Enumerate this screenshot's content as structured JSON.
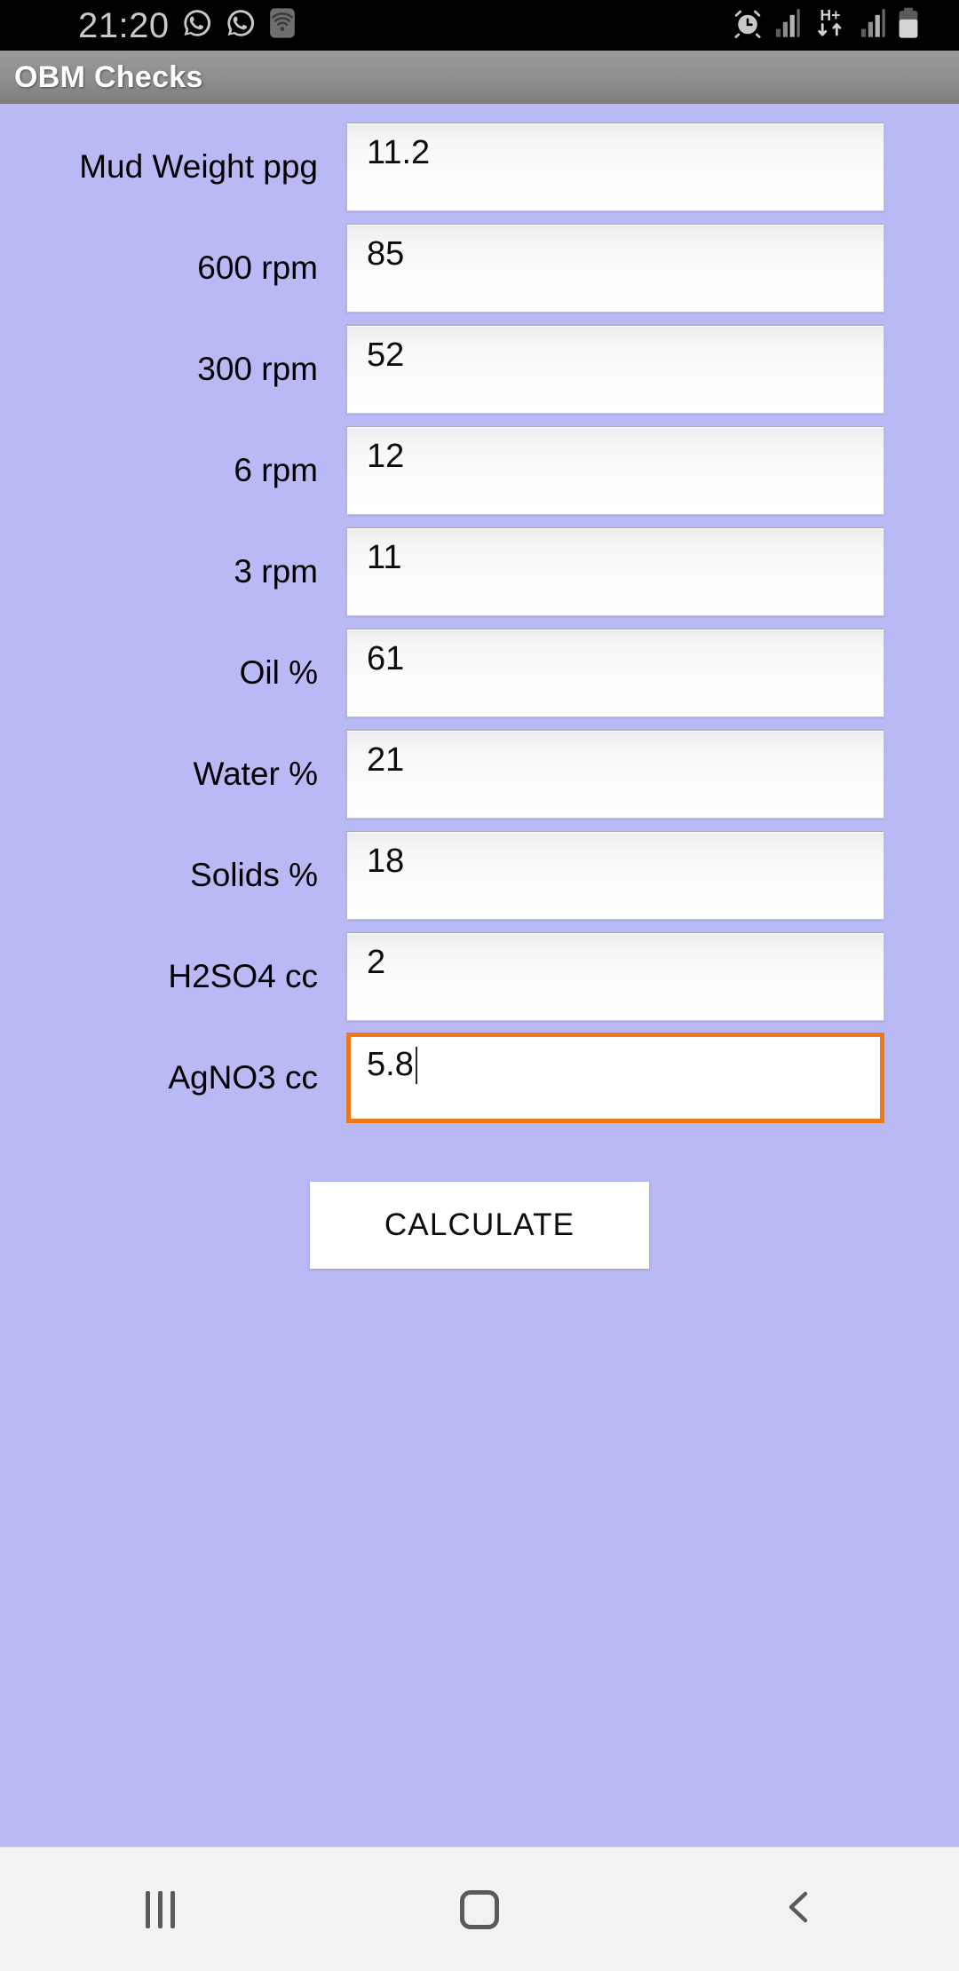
{
  "status_bar": {
    "time": "21:20",
    "left_icons": [
      "whatsapp-icon",
      "whatsapp-icon",
      "wifi-icon"
    ],
    "right_icons": [
      "alarm-icon",
      "signal-bars-icon",
      "hplus-data-icon",
      "signal-bars-icon",
      "battery-icon"
    ],
    "network_label": "H+",
    "background_color": "#000000",
    "foreground_color": "#c8c8c8"
  },
  "app_bar": {
    "title": "OBM Checks",
    "background_color": "#8e8e8e",
    "title_color": "#ffffff"
  },
  "theme": {
    "page_background": "#b9b9f5",
    "field_background": "#fdfdfd",
    "focus_accent": "#ee7718",
    "text_color": "#000000",
    "nav_background": "#f2f2f2"
  },
  "form": {
    "rows": [
      {
        "label": "Mud Weight ppg",
        "value": "11.2",
        "focused": false
      },
      {
        "label": "600 rpm",
        "value": "85",
        "focused": false
      },
      {
        "label": "300 rpm",
        "value": "52",
        "focused": false
      },
      {
        "label": "6 rpm",
        "value": "12",
        "focused": false
      },
      {
        "label": "3 rpm",
        "value": "11",
        "focused": false
      },
      {
        "label": "Oil %",
        "value": "61",
        "focused": false
      },
      {
        "label": "Water %",
        "value": "21",
        "focused": false
      },
      {
        "label": "Solids %",
        "value": "18",
        "focused": false
      },
      {
        "label": "H2SO4 cc",
        "value": "2",
        "focused": false
      },
      {
        "label": "AgNO3 cc",
        "value": "5.8",
        "focused": true
      }
    ]
  },
  "actions": {
    "calculate_label": "CALCULATE"
  },
  "nav_bar": {
    "items": [
      {
        "name": "recents-button",
        "icon": "recents-icon"
      },
      {
        "name": "home-button",
        "icon": "home-icon"
      },
      {
        "name": "back-button",
        "icon": "back-chevron-icon"
      }
    ]
  }
}
